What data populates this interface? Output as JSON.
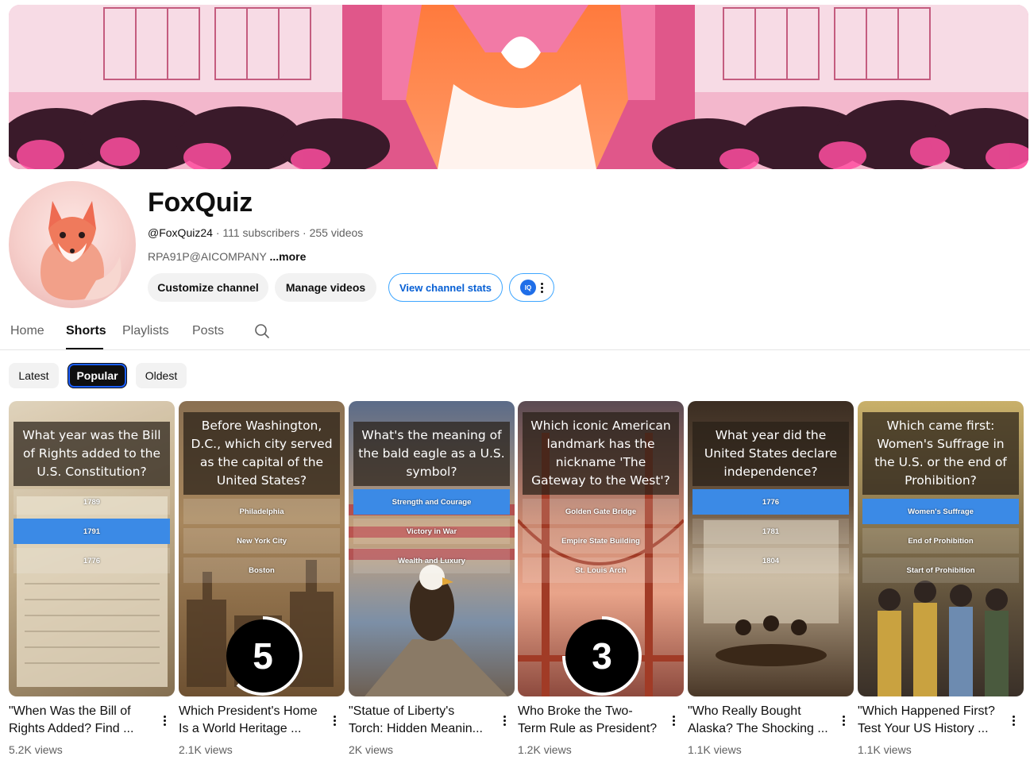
{
  "channel": {
    "name": "FoxQuiz",
    "handle": "@FoxQuiz24",
    "subscribers": "111 subscribers",
    "videos": "255 videos",
    "description": "RPA91P@AICOMPANY",
    "more_label": "...more",
    "separator": "·"
  },
  "actions": {
    "customize": "Customize channel",
    "manage": "Manage videos",
    "stats": "View channel stats",
    "iq_badge": "IQ"
  },
  "tabs": [
    "Home",
    "Shorts",
    "Playlists",
    "Posts"
  ],
  "active_tab": "Shorts",
  "filters": [
    "Latest",
    "Popular",
    "Oldest"
  ],
  "active_filter": "Popular",
  "colors": {
    "accent": "#3ea6ff",
    "answer_highlight": "#3b8ae6",
    "chip_active": "#0f0f0f"
  },
  "shorts": [
    {
      "question": "What year was the Bill of Rights added to the U.S. Constitution?",
      "answers": [
        "1789",
        "1791",
        "1776"
      ],
      "highlighted": 1,
      "countdown": "",
      "title": "\"When Was the Bill of Rights Added? Find ...",
      "views": "5.2K views"
    },
    {
      "question": "Before Washington, D.C., which city served as the capital of the United States?",
      "answers": [
        "Philadelphia",
        "New York City",
        "Boston"
      ],
      "highlighted": -1,
      "countdown": "5",
      "title": "Which President's Home Is a World Heritage ...",
      "views": "2.1K views"
    },
    {
      "question": "What's the meaning of the bald eagle as a U.S. symbol?",
      "answers": [
        "Strength and Courage",
        "Victory in War",
        "Wealth and Luxury"
      ],
      "highlighted": 0,
      "countdown": "",
      "title": "\"Statue of Liberty's Torch: Hidden Meanin...",
      "views": "2K views"
    },
    {
      "question": "Which iconic American landmark has the nickname 'The Gateway to the West'?",
      "answers": [
        "Golden Gate Bridge",
        "Empire State Building",
        "St. Louis Arch"
      ],
      "highlighted": -1,
      "countdown": "3",
      "title": "Who Broke the Two-Term Rule as President?",
      "views": "1.2K views"
    },
    {
      "question": "What year did the United States declare independence?",
      "answers": [
        "1776",
        "1781",
        "1804"
      ],
      "highlighted": 0,
      "countdown": "",
      "title": "\"Who Really Bought Alaska? The Shocking ...",
      "views": "1.1K views"
    },
    {
      "question": "Which came first: Women's Suffrage in the U.S. or the end of Prohibition?",
      "answers": [
        "Women's Suffrage",
        "End of Prohibition",
        "Start of Prohibition"
      ],
      "highlighted": 0,
      "countdown": "",
      "title": "\"Which Happened First? Test Your US History ...",
      "views": "1.1K views"
    }
  ]
}
